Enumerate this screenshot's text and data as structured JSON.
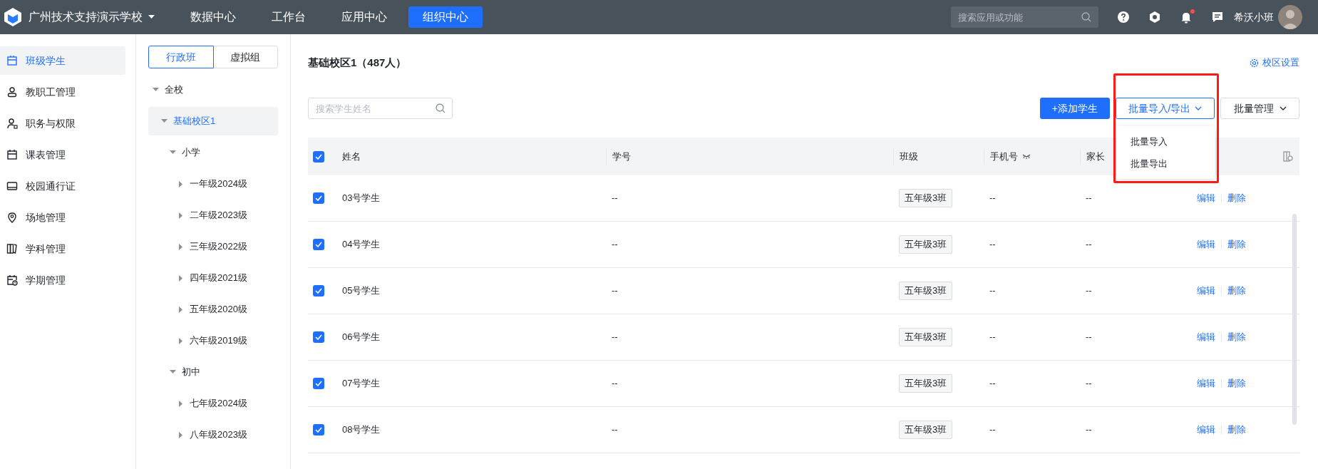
{
  "topbar": {
    "school": "广州技术支持演示学校",
    "nav": [
      {
        "label": "数据中心",
        "selected": false
      },
      {
        "label": "工作台",
        "selected": false
      },
      {
        "label": "应用中心",
        "selected": false
      },
      {
        "label": "组织中心",
        "selected": true
      }
    ],
    "search": {
      "placeholder": "搜索应用或功能"
    },
    "notification": true,
    "user": "希沃小班"
  },
  "sidebar": {
    "items": [
      {
        "label": "班级学生",
        "kind": "class",
        "selected": true
      },
      {
        "label": "教职工管理",
        "kind": "person",
        "selected": false
      },
      {
        "label": "职务与权限",
        "kind": "role",
        "selected": false
      },
      {
        "label": "课表管理",
        "kind": "calendar",
        "selected": false
      },
      {
        "label": "校园通行证",
        "kind": "card",
        "selected": false
      },
      {
        "label": "场地管理",
        "kind": "pin",
        "selected": false
      },
      {
        "label": "学科管理",
        "kind": "book",
        "selected": false
      },
      {
        "label": "学期管理",
        "kind": "term",
        "selected": false
      }
    ]
  },
  "tree_panel": {
    "tabs": [
      {
        "label": "行政班",
        "selected": true
      },
      {
        "label": "虚拟组",
        "selected": false
      }
    ],
    "tree": [
      {
        "label": "全校",
        "expanded": true,
        "selected": false,
        "children": [
          {
            "label": "基础校区1",
            "expanded": true,
            "selected": true,
            "children": [
              {
                "label": "小学",
                "expanded": true,
                "selected": false,
                "children": [
                  {
                    "label": "一年级2024级",
                    "expanded": false,
                    "selected": false
                  },
                  {
                    "label": "二年级2023级",
                    "expanded": false,
                    "selected": false
                  },
                  {
                    "label": "三年级2022级",
                    "expanded": false,
                    "selected": false
                  },
                  {
                    "label": "四年级2021级",
                    "expanded": false,
                    "selected": false
                  },
                  {
                    "label": "五年级2020级",
                    "expanded": false,
                    "selected": false
                  },
                  {
                    "label": "六年级2019级",
                    "expanded": false,
                    "selected": false
                  }
                ]
              },
              {
                "label": "初中",
                "expanded": true,
                "selected": false,
                "children": [
                  {
                    "label": "七年级2024级",
                    "expanded": false,
                    "selected": false
                  },
                  {
                    "label": "八年级2023级",
                    "expanded": false,
                    "selected": false
                  }
                ]
              }
            ]
          }
        ]
      }
    ]
  },
  "main": {
    "title": "基础校区1（487人）",
    "settings_link": "校区设置",
    "search": {
      "placeholder": "搜索学生姓名"
    },
    "add_button": "+添加学生",
    "import_export": {
      "label": "批量导入/导出",
      "open": true,
      "menu": [
        "批量导入",
        "批量导出"
      ]
    },
    "manage_button": "批量管理",
    "table": {
      "all_checked": true,
      "columns": [
        {
          "label": "姓名",
          "kind": "text"
        },
        {
          "label": "学号",
          "kind": "text"
        },
        {
          "label": "班级",
          "kind": "text"
        },
        {
          "label": "手机号",
          "kind": "masked"
        },
        {
          "label": "家长",
          "kind": "text"
        }
      ],
      "rows": [
        {
          "checked": true,
          "name": "03号学生",
          "number": "--",
          "class": "五年级3班",
          "phone": "--",
          "parent": "--",
          "actions": [
            "编辑",
            "删除"
          ]
        },
        {
          "checked": true,
          "name": "04号学生",
          "number": "--",
          "class": "五年级3班",
          "phone": "--",
          "parent": "--",
          "actions": [
            "编辑",
            "删除"
          ]
        },
        {
          "checked": true,
          "name": "05号学生",
          "number": "--",
          "class": "五年级3班",
          "phone": "--",
          "parent": "--",
          "actions": [
            "编辑",
            "删除"
          ]
        },
        {
          "checked": true,
          "name": "06号学生",
          "number": "--",
          "class": "五年级3班",
          "phone": "--",
          "parent": "--",
          "actions": [
            "编辑",
            "删除"
          ]
        },
        {
          "checked": true,
          "name": "07号学生",
          "number": "--",
          "class": "五年级3班",
          "phone": "--",
          "parent": "--",
          "actions": [
            "编辑",
            "删除"
          ]
        },
        {
          "checked": true,
          "name": "08号学生",
          "number": "--",
          "class": "五年级3班",
          "phone": "--",
          "parent": "--",
          "actions": [
            "编辑",
            "删除"
          ]
        }
      ]
    }
  }
}
